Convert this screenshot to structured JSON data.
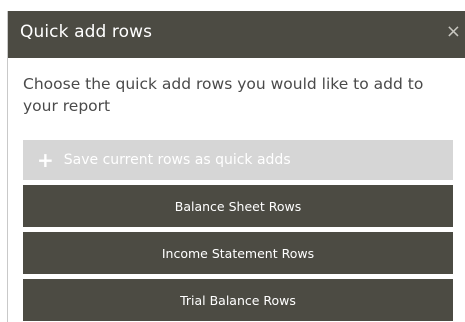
{
  "dialog": {
    "title": "Quick add rows",
    "close_glyph": "×",
    "instructions": "Choose the quick add rows you would like to add to your report",
    "save_button": {
      "icon": "plus-icon",
      "icon_glyph": "+",
      "label": "Save current rows as quick adds"
    },
    "row_buttons": [
      {
        "label": "Balance Sheet Rows"
      },
      {
        "label": "Income Statement Rows"
      },
      {
        "label": "Trial Balance Rows"
      }
    ]
  },
  "colors": {
    "header_bg": "#4c4b43",
    "button_bg": "#4c4b43",
    "disabled_button_bg": "#d6d6d6",
    "text": "#4a4a4a"
  }
}
